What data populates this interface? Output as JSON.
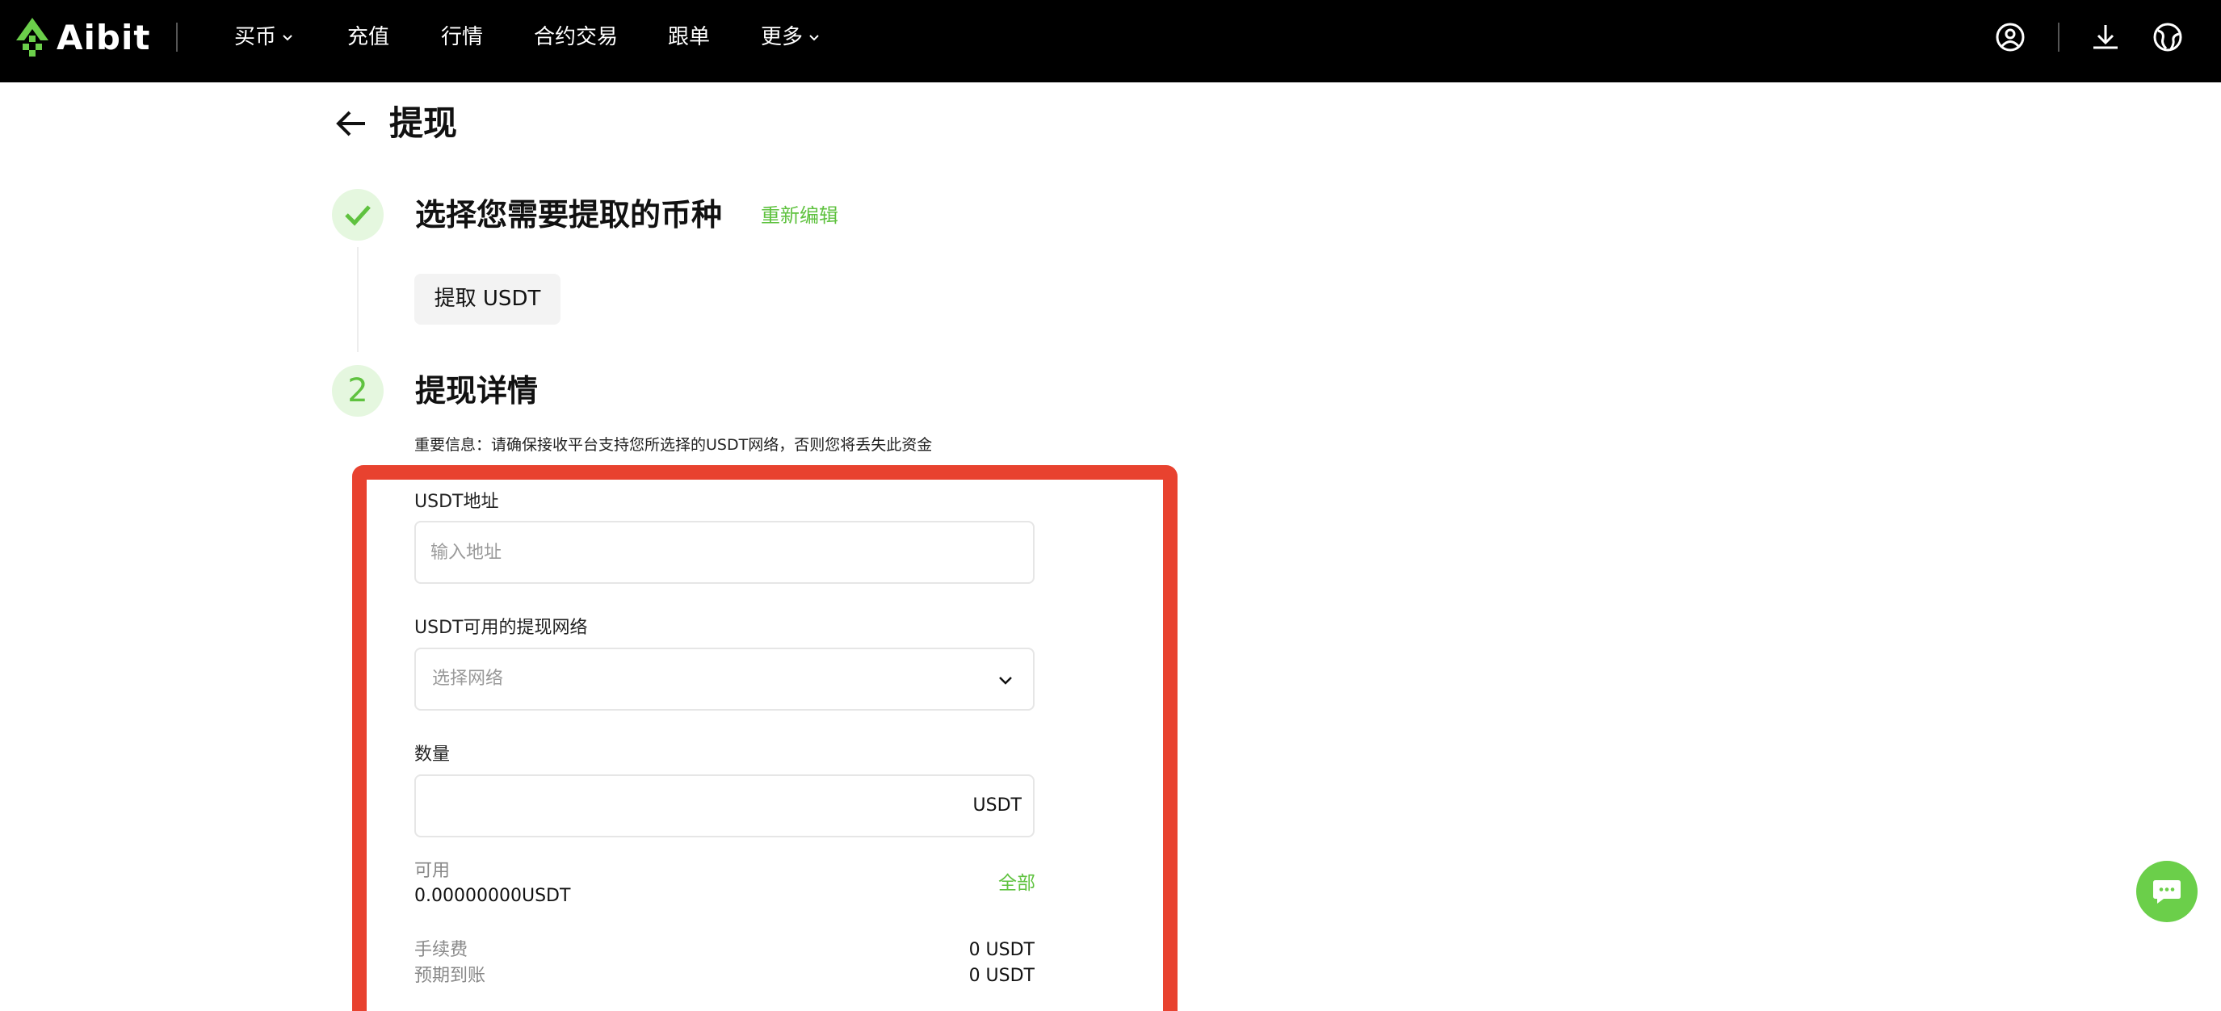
{
  "brand": {
    "name": "Aibit",
    "accent": "#5fc23f",
    "highlight_color": "#e8422f"
  },
  "nav": {
    "items": [
      {
        "label": "买币",
        "has_dropdown": true
      },
      {
        "label": "充值",
        "has_dropdown": false
      },
      {
        "label": "行情",
        "has_dropdown": false
      },
      {
        "label": "合约交易",
        "has_dropdown": false
      },
      {
        "label": "跟单",
        "has_dropdown": false
      },
      {
        "label": "更多",
        "has_dropdown": true
      }
    ],
    "right_icons": [
      "user-icon",
      "download-icon",
      "globe-icon"
    ]
  },
  "page": {
    "title": "提现"
  },
  "step1": {
    "icon": "checkmark-icon",
    "title": "选择您需要提取的币种",
    "re_edit_label": "重新编辑",
    "selected_coin": "提取 USDT"
  },
  "step2": {
    "number": "2",
    "title": "提现详情",
    "notice": "重要信息：请确保接收平台支持您所选择的USDT网络，否则您将丢失此资金"
  },
  "form": {
    "address": {
      "label": "USDT地址",
      "placeholder": "输入地址",
      "value": ""
    },
    "network": {
      "label": "USDT可用的提现网络",
      "placeholder": "选择网络"
    },
    "amount": {
      "label": "数量",
      "suffix": "USDT",
      "value": ""
    },
    "available": {
      "label": "可用",
      "value": "0.00000000USDT",
      "all_label": "全部"
    },
    "fee": {
      "label": "手续费",
      "value": "0 USDT"
    },
    "expected": {
      "label": "预期到账",
      "value": "0 USDT"
    }
  },
  "chat": {
    "icon": "chat-icon"
  }
}
